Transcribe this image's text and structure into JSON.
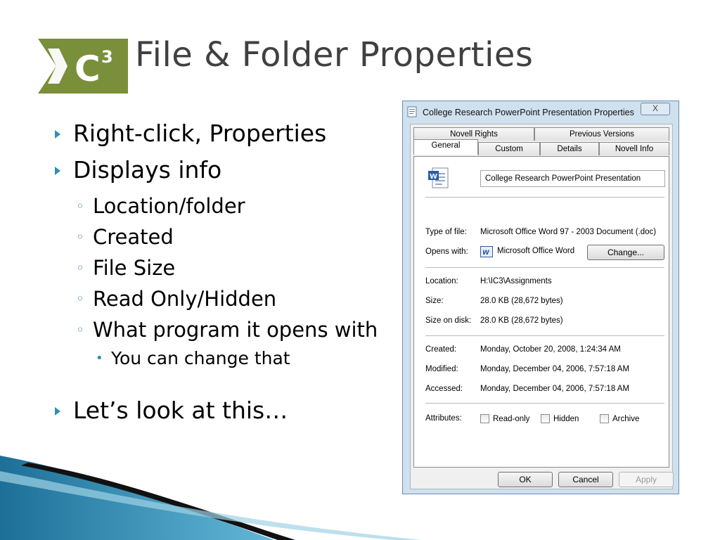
{
  "slide": {
    "title": "File & Folder Properties",
    "logo_text": "IC3",
    "bullets": {
      "b1": "Right-click, Properties",
      "b2": "Displays info",
      "s1": "Location/folder",
      "s2": "Created",
      "s3": "File Size",
      "s4": "Read Only/Hidden",
      "s5": "What program it opens with",
      "t1": "You can change that",
      "b3": "Let’s look at this…",
      "l1_marker": "▸",
      "l2_marker": "◦",
      "l3_marker": "•"
    }
  },
  "dialog": {
    "title": "College Research PowerPoint Presentation Properties",
    "close_label": "X",
    "tabs": {
      "novell_rights": "Novell Rights",
      "previous_versions": "Previous Versions",
      "general": "General",
      "custom": "Custom",
      "details": "Details",
      "novell_info": "Novell Info"
    },
    "file_name": "College Research PowerPoint Presentation",
    "labels": {
      "type": "Type of file:",
      "opens": "Opens with:",
      "location": "Location:",
      "size": "Size:",
      "size_on_disk": "Size on disk:",
      "created": "Created:",
      "modified": "Modified:",
      "accessed": "Accessed:",
      "attributes": "Attributes:"
    },
    "values": {
      "type": "Microsoft Office Word 97 - 2003 Document (.doc)",
      "opens": "Microsoft Office Word",
      "location": "H:\\IC3\\Assignments",
      "size": "28.0 KB (28,672 bytes)",
      "size_on_disk": "28.0 KB (28,672 bytes)",
      "created": "Monday, October 20, 2008, 1:24:34 AM",
      "modified": "Monday, December 04, 2006, 7:57:18 AM",
      "accessed": "Monday, December 04, 2006, 7:57:18 AM"
    },
    "change_button": "Change...",
    "attributes": {
      "read_only": "Read-only",
      "hidden": "Hidden",
      "archive": "Archive"
    },
    "buttons": {
      "ok": "OK",
      "cancel": "Cancel",
      "apply": "Apply"
    }
  },
  "colors": {
    "logo_green": "#7a8f3a",
    "title_gray": "#404040",
    "bullet_accent": "#2f8fb5",
    "dialog_frame": "#cfe0ee"
  }
}
